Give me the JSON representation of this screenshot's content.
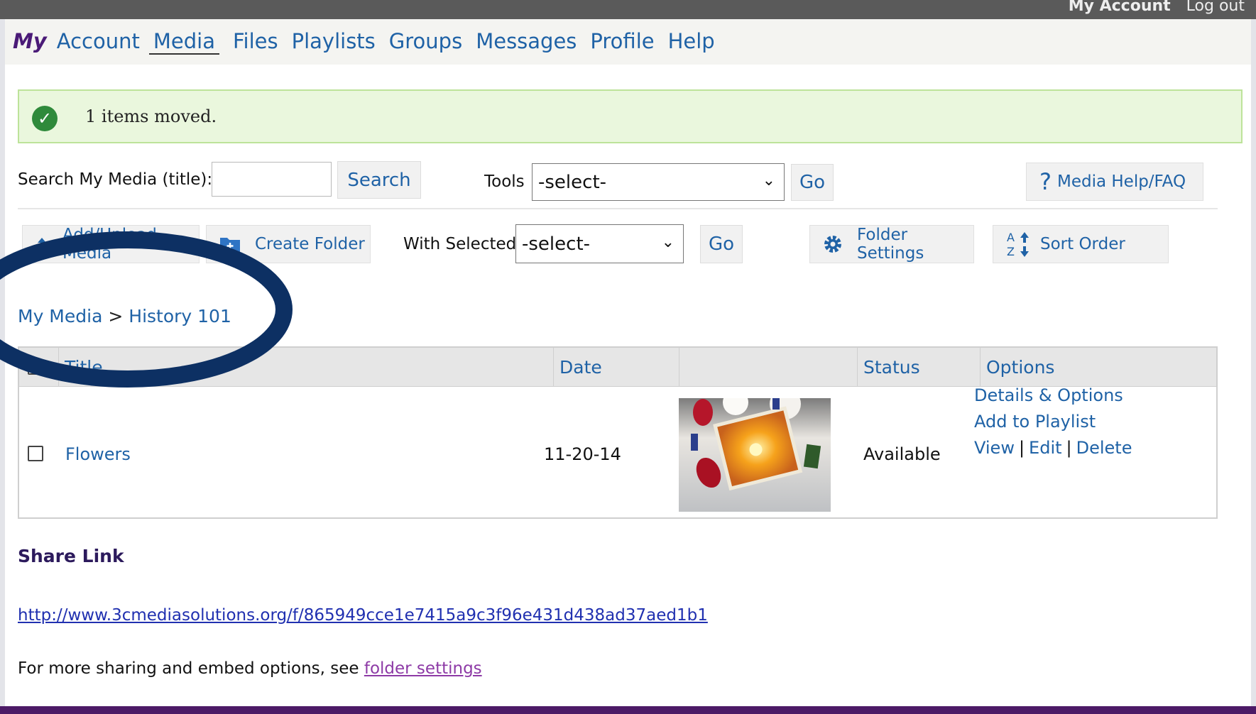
{
  "topbar": {
    "account": "My Account",
    "logout": "Log out"
  },
  "nav": {
    "prefix": "My",
    "items": [
      "Account",
      "Media",
      "Files",
      "Playlists",
      "Groups",
      "Messages",
      "Profile",
      "Help"
    ],
    "active": "Media"
  },
  "notice": {
    "message": "1 items moved."
  },
  "search": {
    "label": "Search My Media (title):",
    "value": "",
    "button": "Search"
  },
  "tools": {
    "label": "Tools",
    "selected": "-select-",
    "go": "Go"
  },
  "help": {
    "label": "Media Help/FAQ"
  },
  "toolbar": {
    "add_upload": "Add/Upload Media",
    "create_folder": "Create Folder",
    "with_selected_label": "With Selected",
    "with_selected_value": "-select-",
    "go": "Go",
    "folder_settings": "Folder Settings",
    "sort_order": "Sort Order"
  },
  "breadcrumb": {
    "root": "My Media",
    "separator": ">",
    "current": "History 101"
  },
  "table": {
    "headers": {
      "title": "Title",
      "date": "Date",
      "thumb": "",
      "status": "Status",
      "options": "Options"
    },
    "rows": [
      {
        "title": "Flowers",
        "date": "11-20-14",
        "status": "Available",
        "options": {
          "details": "Details & Options",
          "playlist": "Add to Playlist",
          "view": "View",
          "edit": "Edit",
          "delete": "Delete"
        }
      }
    ]
  },
  "share": {
    "heading": "Share Link",
    "url": "http://www.3cmediasolutions.org/f/865949cce1e7415a9c3f96e431d438ad37aed1b1",
    "more_text": "For more sharing and embed options, see ",
    "more_link": "folder settings"
  },
  "icons": [
    "check-circle-icon",
    "upload-icon",
    "folder-plus-icon",
    "question-icon",
    "gear-icon",
    "sort-az-icon",
    "chevron-down-icon",
    "checkbox-icon"
  ],
  "colors": {
    "link": "#1f62a6",
    "notice_bg": "#eaf7dd",
    "footer": "#4c1a66",
    "annotation": "#0d3063"
  }
}
